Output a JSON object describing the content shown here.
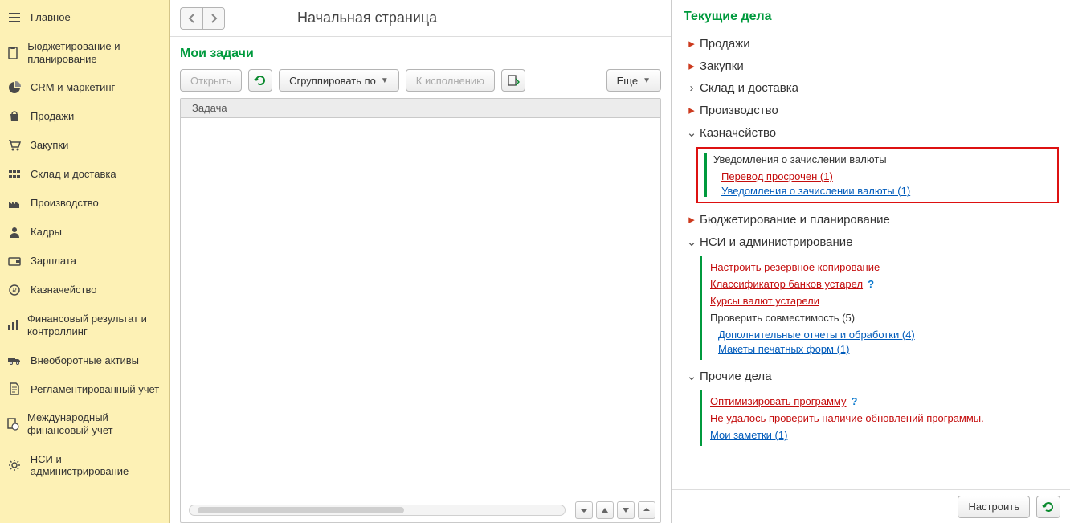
{
  "sidebar": {
    "items": [
      {
        "label": "Главное",
        "icon": "menu"
      },
      {
        "label": "Бюджетирование и планирование",
        "icon": "clipboard"
      },
      {
        "label": "CRM и маркетинг",
        "icon": "pie"
      },
      {
        "label": "Продажи",
        "icon": "bag"
      },
      {
        "label": "Закупки",
        "icon": "cart"
      },
      {
        "label": "Склад и доставка",
        "icon": "shelves"
      },
      {
        "label": "Производство",
        "icon": "factory"
      },
      {
        "label": "Кадры",
        "icon": "person"
      },
      {
        "label": "Зарплата",
        "icon": "wallet"
      },
      {
        "label": "Казначейство",
        "icon": "coin"
      },
      {
        "label": "Финансовый результат и контроллинг",
        "icon": "bars"
      },
      {
        "label": "Внеоборотные активы",
        "icon": "truck"
      },
      {
        "label": "Регламентированный учет",
        "icon": "doc"
      },
      {
        "label": "Международный финансовый учет",
        "icon": "globe-doc"
      },
      {
        "label": "НСИ и администрирование",
        "icon": "gear"
      }
    ]
  },
  "header": {
    "title": "Начальная страница"
  },
  "tasks": {
    "title": "Мои задачи",
    "toolbar": {
      "open": "Открыть",
      "group_by": "Сгруппировать по",
      "due": "К исполнению",
      "more": "Еще"
    },
    "grid": {
      "col_task": "Задача"
    }
  },
  "cd": {
    "title": "Текущие дела",
    "sales": "Продажи",
    "purchases": "Закупки",
    "warehouse": "Склад и доставка",
    "production": "Производство",
    "treasury": "Казначейство",
    "treasury_box": {
      "title": "Уведомления о зачислении валюты",
      "overdue": "Перевод просрочен (1)",
      "notif": "Уведомления о зачислении валюты (1)"
    },
    "budgeting": "Бюджетирование и планирование",
    "admin": "НСИ и администрирование",
    "admin_links": {
      "backup": "Настроить резервное копирование",
      "banks": "Классификатор банков устарел",
      "rates": "Курсы валют устарели",
      "compat": "Проверить совместимость (5)",
      "addreps": "Дополнительные отчеты и обработки (4)",
      "printforms": "Макеты печатных форм (1)"
    },
    "other": "Прочие дела",
    "other_links": {
      "optimize": "Оптимизировать программу",
      "noupdate": "Не удалось проверить наличие обновлений программы.",
      "notes": "Мои заметки (1)"
    }
  },
  "footer": {
    "configure": "Настроить"
  }
}
